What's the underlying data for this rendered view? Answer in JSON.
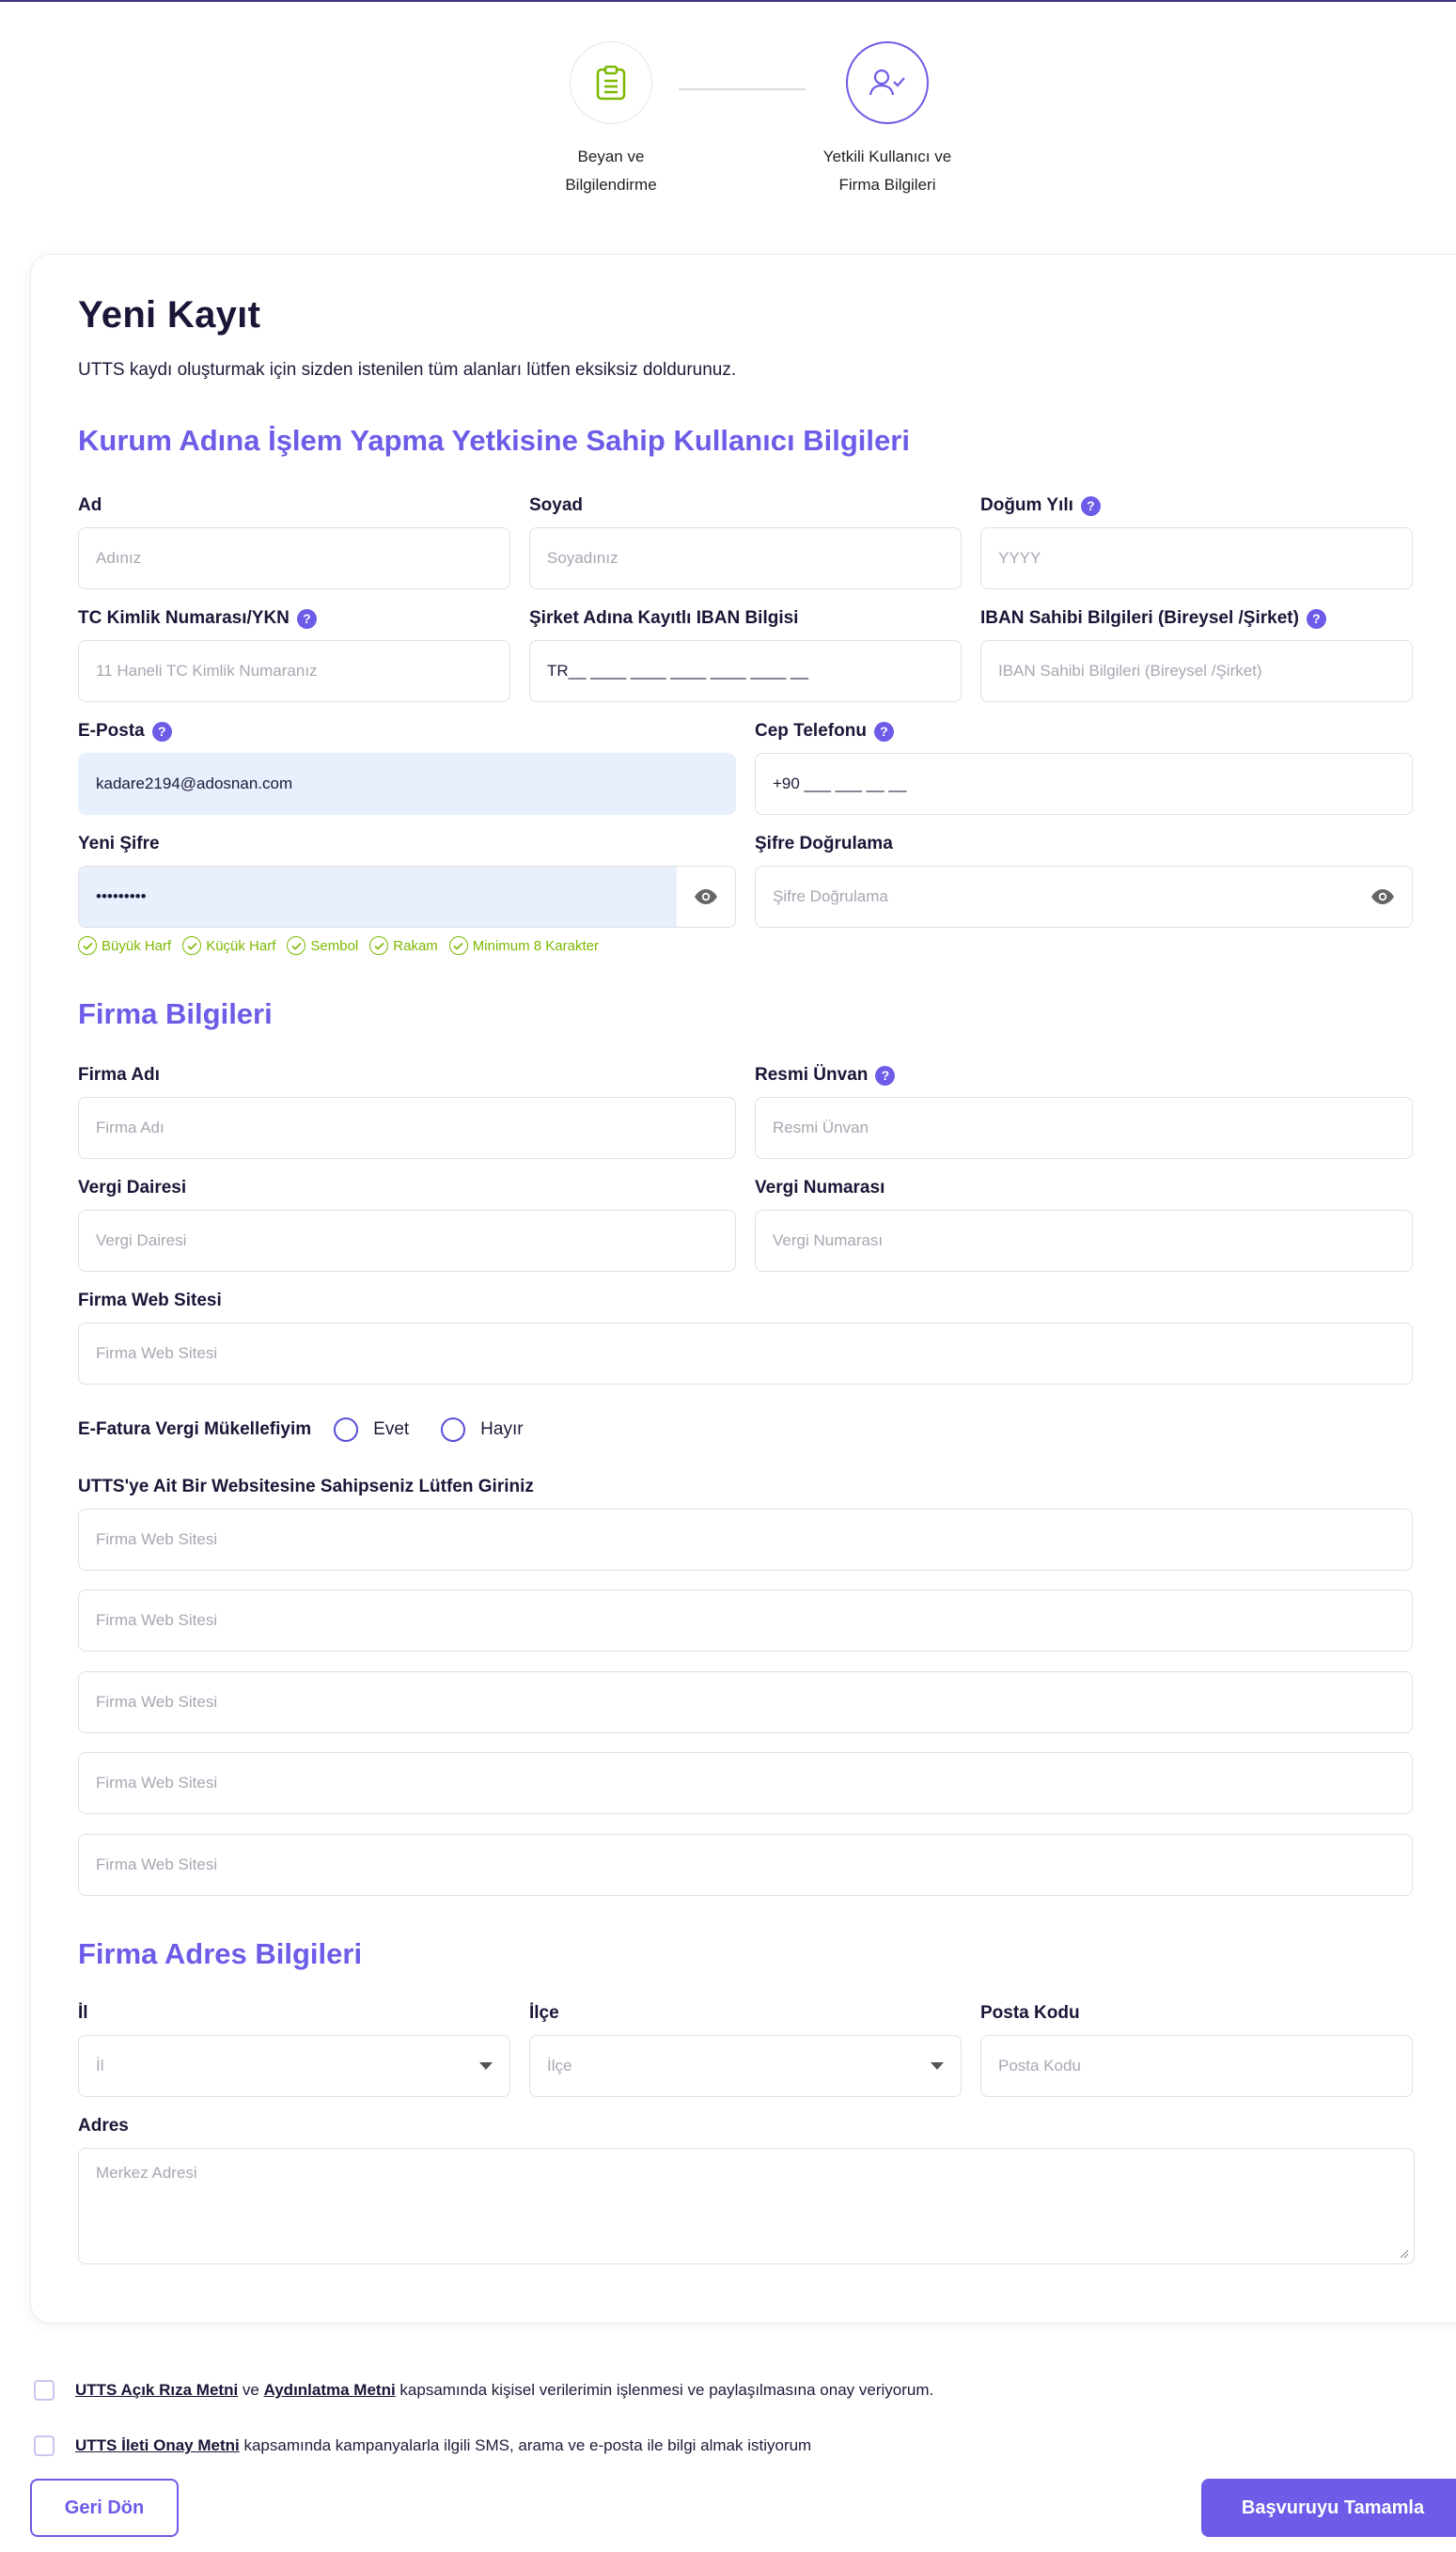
{
  "steps": [
    {
      "label_line1": "Beyan ve",
      "label_line2": "Bilgilendirme",
      "icon": "clipboard-icon",
      "color": "#7cb800"
    },
    {
      "label_line1": "Yetkili Kullanıcı ve",
      "label_line2": "Firma Bilgileri",
      "icon": "user-check-icon",
      "color": "#6c5ce7"
    }
  ],
  "header": {
    "title": "Yeni Kayıt",
    "subtitle": "UTTS kaydı oluşturmak için sizden istenilen tüm alanları lütfen eksiksiz doldurunuz."
  },
  "user_section": {
    "title": "Kurum Adına İşlem Yapma Yetkisine Sahip Kullanıcı Bilgileri",
    "ad": {
      "label": "Ad",
      "placeholder": "Adınız"
    },
    "soyad": {
      "label": "Soyad",
      "placeholder": "Soyadınız"
    },
    "dogum_yili": {
      "label": "Doğum Yılı",
      "placeholder": "YYYY"
    },
    "tc": {
      "label": "TC Kimlik Numarası/YKN",
      "placeholder": "11 Haneli TC Kimlik Numaranız"
    },
    "iban": {
      "label": "Şirket Adına Kayıtlı IBAN Bilgisi",
      "value": "TR__ ____ ____ ____ ____ ____ __"
    },
    "iban_sahibi": {
      "label": "IBAN Sahibi Bilgileri (Bireysel /Şirket)",
      "placeholder": "IBAN Sahibi Bilgileri (Bireysel /Şirket)"
    },
    "email": {
      "label": "E-Posta",
      "value": "kadare2194@adosnan.com"
    },
    "telefon": {
      "label": "Cep Telefonu",
      "value": "+90 ___ ___ __ __"
    },
    "sifre": {
      "label": "Yeni Şifre",
      "value": "•••••••••"
    },
    "sifre_dogrulama": {
      "label": "Şifre Doğrulama",
      "placeholder": "Şifre Doğrulama"
    },
    "rules": [
      "Büyük Harf",
      "Küçük Harf",
      "Sembol",
      "Rakam",
      "Minimum 8 Karakter"
    ]
  },
  "firm_section": {
    "title": "Firma Bilgileri",
    "firma_adi": {
      "label": "Firma Adı",
      "placeholder": "Firma Adı"
    },
    "resmi_unvan": {
      "label": "Resmi Ünvan",
      "placeholder": "Resmi Ünvan"
    },
    "vergi_dairesi": {
      "label": "Vergi Dairesi",
      "placeholder": "Vergi Dairesi"
    },
    "vergi_numarasi": {
      "label": "Vergi Numarası",
      "placeholder": "Vergi Numarası"
    },
    "web_sitesi": {
      "label": "Firma Web Sitesi",
      "placeholder": "Firma Web Sitesi"
    },
    "efatura": {
      "label": "E-Fatura Vergi Mükellefiyim",
      "yes": "Evet",
      "no": "Hayır"
    },
    "utts_sites": {
      "label": "UTTS'ye Ait Bir Websitesine Sahipseniz Lütfen Giriniz",
      "placeholders": [
        "Firma Web Sitesi",
        "Firma Web Sitesi",
        "Firma Web Sitesi",
        "Firma Web Sitesi",
        "Firma Web Sitesi"
      ]
    }
  },
  "address_section": {
    "title": "Firma Adres Bilgileri",
    "il": {
      "label": "İl",
      "placeholder": "İl"
    },
    "ilce": {
      "label": "İlçe",
      "placeholder": "İlçe"
    },
    "posta_kodu": {
      "label": "Posta Kodu",
      "placeholder": "Posta Kodu"
    },
    "adres": {
      "label": "Adres",
      "placeholder": "Merkez Adresi"
    }
  },
  "consents": [
    {
      "link1": "UTTS Açık Rıza Metni",
      "mid": " ve ",
      "link2": "Aydınlatma Metni",
      "rest": " kapsamında kişisel verilerimin işlenmesi ve paylaşılmasına onay veriyorum."
    },
    {
      "link1": "UTTS İleti Onay Metni",
      "rest": " kapsamında kampanyalarla ilgili SMS, arama ve e-posta ile bilgi almak istiyorum"
    }
  ],
  "buttons": {
    "back": "Geri Dön",
    "submit": "Başvuruyu Tamamla"
  },
  "colors": {
    "accent": "#6c5ce7",
    "success": "#7cb800",
    "filled_bg": "#e8effd"
  }
}
